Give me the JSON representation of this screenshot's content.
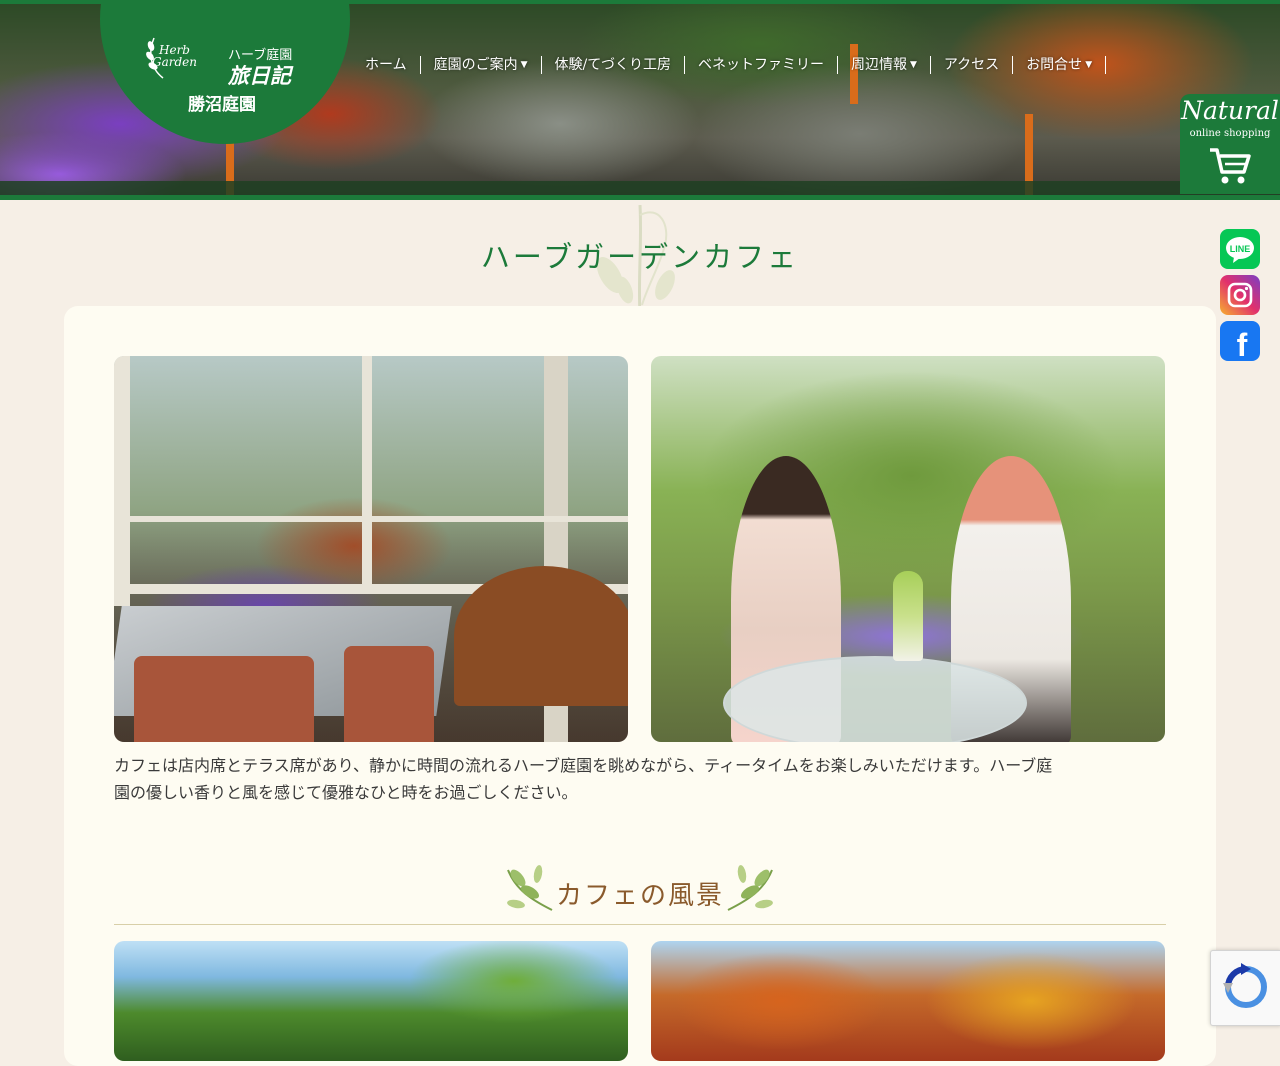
{
  "logo": {
    "herb": "Herb",
    "garden": "Garden",
    "line1": "ハーブ庭園",
    "line2": "旅日記",
    "line3": "勝沼庭園"
  },
  "nav": {
    "items": [
      {
        "label": "ホーム"
      },
      {
        "label": "庭園のご案内",
        "dropdown": true
      },
      {
        "label": "体験/てづくり工房"
      },
      {
        "label": "ベネットファミリー"
      },
      {
        "label": "周辺情報",
        "dropdown": true
      },
      {
        "label": "アクセス"
      },
      {
        "label": "お問合せ",
        "dropdown": true
      }
    ]
  },
  "shop": {
    "title": "Natural",
    "subtitle": "online shopping",
    "icon": "cart-icon"
  },
  "social": [
    {
      "name": "line-icon",
      "label": "LINE",
      "color": "#06c755"
    },
    {
      "name": "instagram-icon",
      "color": "#e1306c"
    },
    {
      "name": "facebook-icon",
      "label": "f",
      "color": "#1877f2"
    }
  ],
  "main": {
    "title": "ハーブガーデンカフェ",
    "intro_line1": "カフェは店内席とテラス席があり、静かに時間の流れるハーブ庭園を眺めながら、ティータイムをお楽しみいただけます。ハーブ庭",
    "intro_line2": "園の優しい香りと風を感じて優雅なひと時をお過ごしください。",
    "section_title": "カフェの風景"
  },
  "colors": {
    "brand_green": "#1c7a3a",
    "page_bg": "#f6efe6",
    "card_bg": "#fefcf2",
    "section_title": "#8a5a2c"
  }
}
